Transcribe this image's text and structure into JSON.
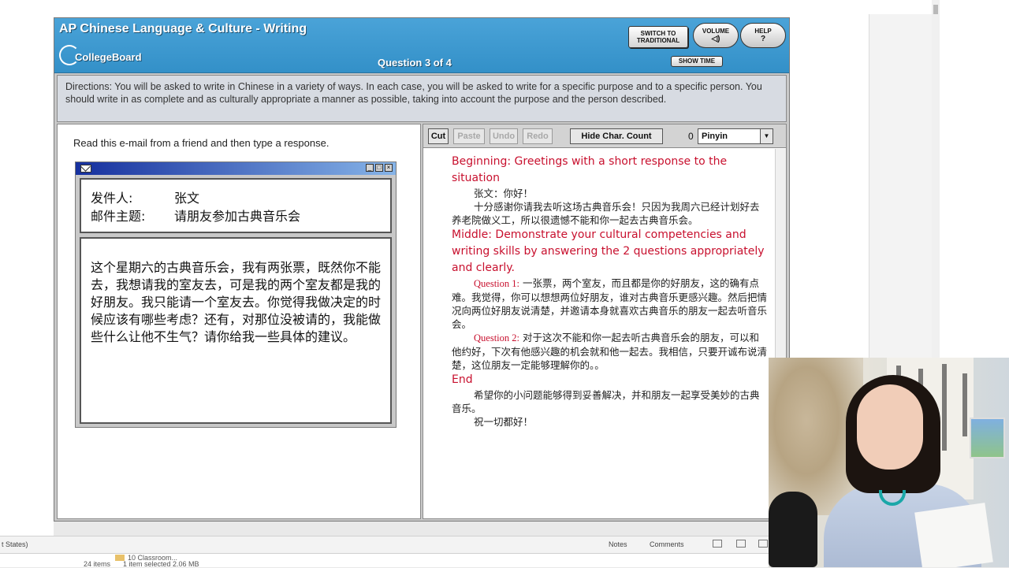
{
  "exam": {
    "title": "AP Chinese Language & Culture - Writing",
    "logo_text": "CollegeBoard",
    "question_label": "Question 3 of 4",
    "buttons": {
      "switch_traditional": "SWITCH TO TRADITIONAL",
      "volume": "VOLUME",
      "help": "HELP",
      "show_time": "SHOW TIME"
    },
    "directions": "Directions: You will be asked to write in Chinese in a variety of ways. In each case, you will be asked to write for a specific purpose and to a specific person. You should write in as complete and as culturally appropriate a manner as possible, taking into account the purpose and the person described."
  },
  "left": {
    "prompt": "Read this e-mail from a friend and then type a response.",
    "email": {
      "sender_label": "发件人:",
      "sender": "张文",
      "subject_label": "邮件主题:",
      "subject": "请朋友参加古典音乐会",
      "body": "这个星期六的古典音乐会，我有两张票，既然你不能去，我想请我的室友去，可是我的两个室友都是我的好朋友。我只能请一个室友去。你觉得我做决定的时候应该有哪些考虑？还有，对那位没被请的，我能做些什么让他不生气？请你给我一些具体的建议。"
    }
  },
  "right": {
    "toolbar": {
      "cut": "Cut",
      "paste": "Paste",
      "undo": "Undo",
      "redo": "Redo",
      "hide_char_count": "Hide Char. Count",
      "char_count": "0",
      "ime": "Pinyin"
    },
    "response": {
      "beginning_heading": "Beginning: Greetings with a short response to the situation",
      "greeting": "张文：你好！",
      "para1": "十分感谢你请我去听这场古典音乐会！只因为我周六已经计划好去养老院做义工，所以很遗憾不能和你一起去古典音乐会。",
      "middle_heading": "Middle: Demonstrate your cultural competencies and writing skills by answering the 2 questions appropriately and clearly.",
      "q1_label": "Question 1:",
      "q1_text": "一张票，两个室友，而且都是你的好朋友，这的确有点难。我觉得，你可以想想两位好朋友，谁对古典音乐更感兴趣。然后把情况向两位好朋友说清楚，并邀请本身就喜欢古典音乐的朋友一起去听音乐会。",
      "q2_label": "Question 2:",
      "q2_text": "对于这次不能和你一起去听古典音乐会的朋友，可以和他约好，下次有他感兴趣的机会就和他一起去。我相信，只要开诚布说清楚，这位朋友一定能够理解你的。。",
      "end_heading": "End",
      "closing": "希望你的小问题能够得到妥善解决，并和朋友一起享受美妙的古典音乐。",
      "signoff": "祝一切都好！"
    }
  },
  "host": {
    "status_left": "t States)",
    "notes": "Notes",
    "comments": "Comments",
    "explorer_items": "24 items",
    "explorer_selected": "1 item selected  2.06 MB",
    "explorer_folder": "10 Classroom..."
  },
  "colors": {
    "header_blue": "#3390c8",
    "response_red": "#c8102e",
    "panel_gray": "#c9c9c9"
  }
}
